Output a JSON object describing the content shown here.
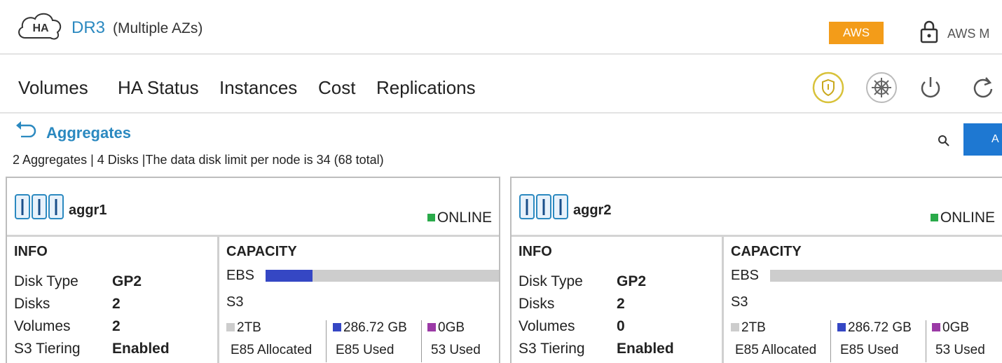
{
  "header": {
    "logo_text": "HA",
    "app_name": "DR3",
    "app_subtitle": "(Multiple AZs)",
    "provider_badge": "AWS",
    "account_name": "AWS M"
  },
  "nav": {
    "tabs": [
      {
        "label": "Volumes"
      },
      {
        "label": "HA Status"
      },
      {
        "label": "Instances"
      },
      {
        "label": "Cost"
      },
      {
        "label": "Replications"
      }
    ],
    "icons": [
      "shield-icon",
      "helm-icon",
      "power-icon",
      "refresh-icon"
    ]
  },
  "section": {
    "title": "Aggregates",
    "summary": "2 Aggregates | 4 Disks  |The data disk limit per node is 34 (68 total)",
    "action_button_label": "A"
  },
  "colors": {
    "accent_blue": "#2b89c0",
    "badge_orange": "#f39c19",
    "online_green": "#2aaa4a",
    "used_blue": "#3547c4",
    "s3_purple": "#9b3aa6",
    "bar_gray": "#cdcdcd"
  },
  "aggregates": [
    {
      "name": "aggr1",
      "status": "ONLINE",
      "info_title": "INFO",
      "capacity_title": "CAPACITY",
      "info": [
        {
          "label": "Disk Type",
          "value": "GP2"
        },
        {
          "label": "Disks",
          "value": "2"
        },
        {
          "label": "Volumes",
          "value": "2"
        },
        {
          "label": "S3 Tiering",
          "value": "Enabled"
        }
      ],
      "ebs_label": "EBS",
      "s3_label": "S3",
      "ebs_used_fraction": 0.2,
      "legend": [
        {
          "value": "2TB",
          "sub": "E85 Allocated"
        },
        {
          "value": "286.72 GB",
          "sub": "E85 Used"
        },
        {
          "value": "0GB",
          "sub": "53 Used"
        }
      ]
    },
    {
      "name": "aggr2",
      "status": "ONLINE",
      "info_title": "INFO",
      "capacity_title": "CAPACITY",
      "info": [
        {
          "label": "Disk Type",
          "value": "GP2"
        },
        {
          "label": "Disks",
          "value": "2"
        },
        {
          "label": "Volumes",
          "value": "0"
        },
        {
          "label": "S3 Tiering",
          "value": "Enabled"
        }
      ],
      "ebs_label": "EBS",
      "s3_label": "S3",
      "ebs_used_fraction": 0,
      "legend": [
        {
          "value": "2TB",
          "sub": "E85 Allocated"
        },
        {
          "value": "286.72 GB",
          "sub": "E85 Used"
        },
        {
          "value": "0GB",
          "sub": "53 Used"
        }
      ]
    }
  ]
}
